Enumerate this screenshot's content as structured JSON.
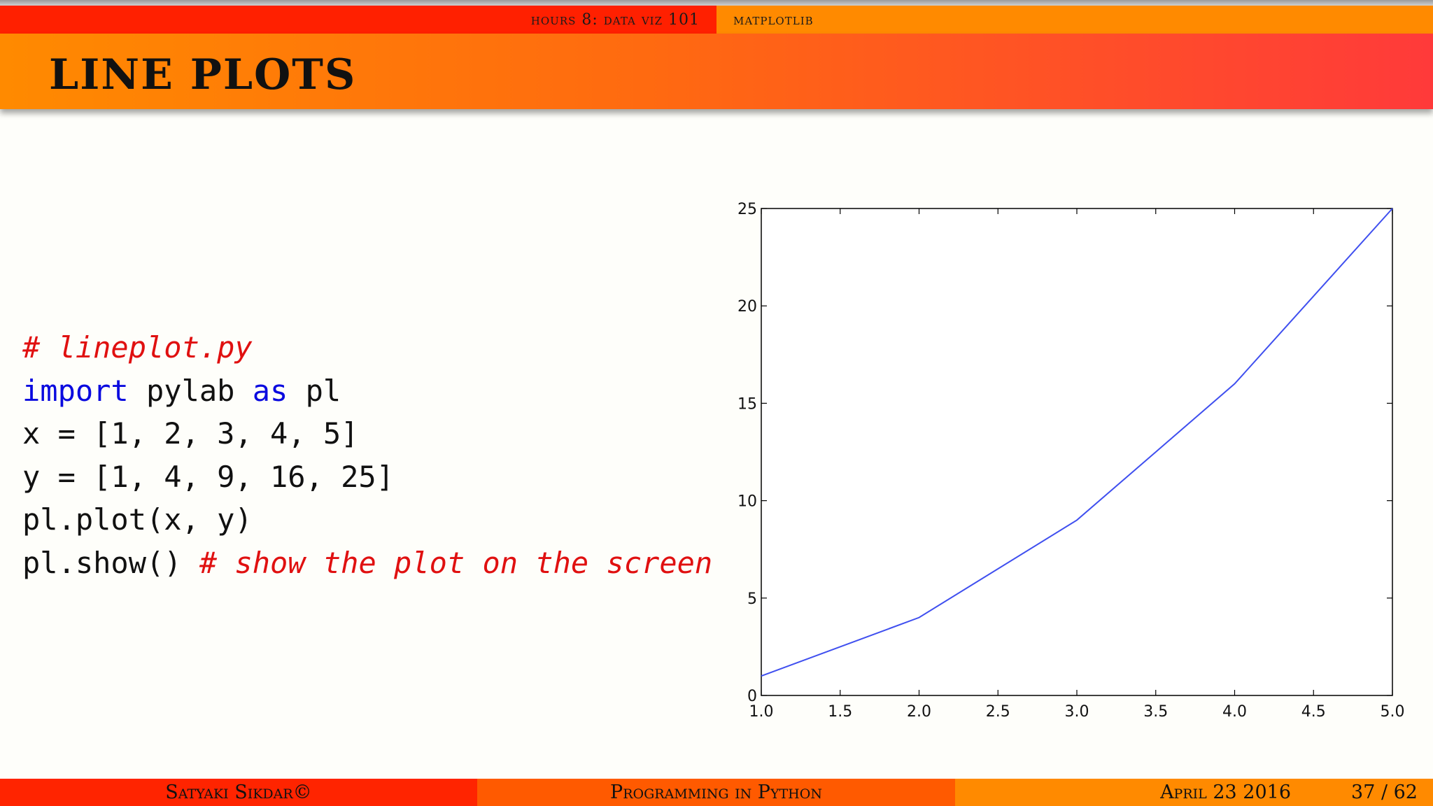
{
  "nav": {
    "section": "hours 8: data viz 101",
    "subsection": "matplotlib"
  },
  "title": "LINE PLOTS",
  "code": {
    "line1_comment": "# lineplot.py",
    "line2_kw1": "import",
    "line2_mid": " pylab ",
    "line2_kw2": "as",
    "line2_end": " pl",
    "line3": "x = [1, 2, 3, 4, 5]",
    "line4": "y = [1, 4, 9, 16, 25]",
    "line5": "pl.plot(x, y)",
    "line6_code": "pl.show() ",
    "line6_comment": "# show the plot on the screen"
  },
  "chart_data": {
    "type": "line",
    "x": [
      1,
      2,
      3,
      4,
      5
    ],
    "series": [
      {
        "values": [
          1,
          4,
          9,
          16,
          25
        ],
        "color": "#3f4fef"
      }
    ],
    "xlim": [
      1.0,
      5.0
    ],
    "ylim": [
      0,
      25
    ],
    "xticks": [
      "1.0",
      "1.5",
      "2.0",
      "2.5",
      "3.0",
      "3.5",
      "4.0",
      "4.5",
      "5.0"
    ],
    "yticks": [
      "0",
      "5",
      "10",
      "15",
      "20",
      "25"
    ],
    "title": "",
    "xlabel": "",
    "ylabel": "",
    "grid": false
  },
  "footer": {
    "author": "Satyaki Sikdar©",
    "course": "Programming in Python",
    "date": "April 23 2016",
    "page": "37 / 62"
  },
  "colors": {
    "red": "#ff2400",
    "orange": "#ff8a00",
    "mid": "#ff5a00"
  }
}
